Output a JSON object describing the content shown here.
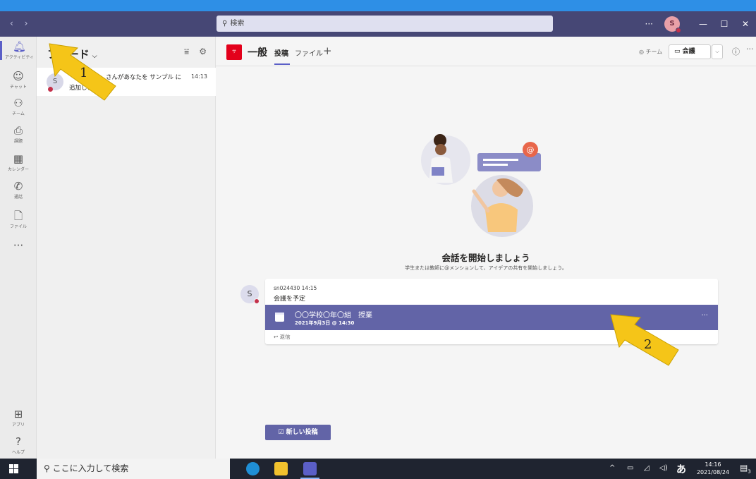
{
  "titlebar": {
    "nav_arrows": "‹  ›",
    "search_placeholder": "検索",
    "more": "···",
    "avatar_initial": "S",
    "minimize": "—",
    "maximize": "☐",
    "close": "✕"
  },
  "rail": {
    "items": [
      {
        "label": "アクティビティ",
        "icon": "bell-icon"
      },
      {
        "label": "チャット",
        "icon": "chat-icon"
      },
      {
        "label": "チーム",
        "icon": "teams-icon"
      },
      {
        "label": "課題",
        "icon": "assignments-icon"
      },
      {
        "label": "カレンダー",
        "icon": "calendar-icon"
      },
      {
        "label": "通話",
        "icon": "phone-icon"
      },
      {
        "label": "ファイル",
        "icon": "file-icon"
      },
      {
        "label": "···",
        "icon": "more-icon"
      },
      {
        "label": "アプリ",
        "icon": "apps-icon"
      },
      {
        "label": "ヘルプ",
        "icon": "help-icon"
      }
    ]
  },
  "activity": {
    "title": "フィード",
    "item": {
      "avatar_initial": "S",
      "line1": "さんがあなたを サンプル に",
      "line2": "追加しました",
      "time": "14:13"
    }
  },
  "channel": {
    "team_icon_label": "サ",
    "name": "一般",
    "tabs": [
      "投稿",
      "ファイル"
    ],
    "add_tab": "+",
    "team_view": "◎ チーム",
    "meet_label": "会議",
    "meet_dropdown": "⌵",
    "info": "ⓘ",
    "more": "···"
  },
  "welcome": {
    "title": "会話を開始しましょう",
    "subtitle": "学生または教師に@メンションして、アイデアの共有を開始しましょう。"
  },
  "post": {
    "avatar_initial": "S",
    "meta": "sn024430  14:15",
    "title": "会議を予定",
    "meeting_title": "〇〇学校〇年〇組　授業",
    "meeting_date": "2021年9月3日 @ 14:30",
    "meeting_more": "···",
    "reply": "↩ 返信"
  },
  "new_post_button": "☑  新しい投稿",
  "annotations": {
    "arrow1": "1",
    "arrow2": "2",
    "color": "#f5c518"
  },
  "taskbar": {
    "search_placeholder": "ここに入力して検索",
    "tray_chevron": "^",
    "ime": "あ",
    "time": "14:16",
    "date": "2021/08/24",
    "notification_count": "3"
  },
  "colors": {
    "titlebar": "#464775",
    "accent": "#6264a7",
    "status_red": "#c4314b"
  }
}
